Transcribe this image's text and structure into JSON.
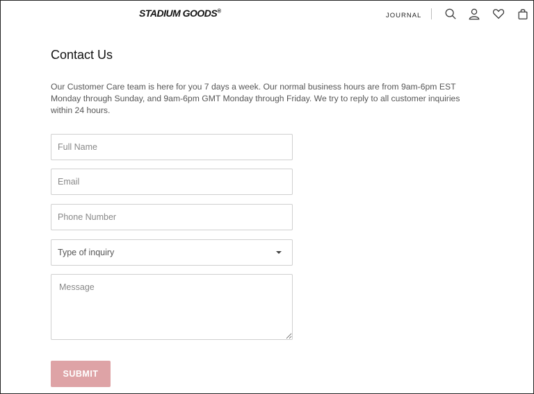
{
  "header": {
    "logo_text": "STADIUM GOODS",
    "logo_mark": "®",
    "nav_journal": "JOURNAL",
    "icons": [
      "search-icon",
      "account-icon",
      "heart-icon",
      "bag-icon"
    ]
  },
  "page": {
    "title": "Contact Us",
    "intro": "Our Customer Care team is here for you 7 days a week. Our normal business hours are from 9am-6pm EST Monday through Sunday, and 9am-6pm GMT Monday through Friday. We try to reply to all customer inquiries within 24 hours."
  },
  "form": {
    "full_name_placeholder": "Full Name",
    "email_placeholder": "Email",
    "phone_placeholder": "Phone Number",
    "inquiry_selected": "Type of inquiry",
    "message_placeholder": "Message",
    "submit_label": "SUBMIT"
  },
  "colors": {
    "submit_bg": "#dea3a6",
    "border": "#cfcfcf",
    "text": "#222222"
  }
}
